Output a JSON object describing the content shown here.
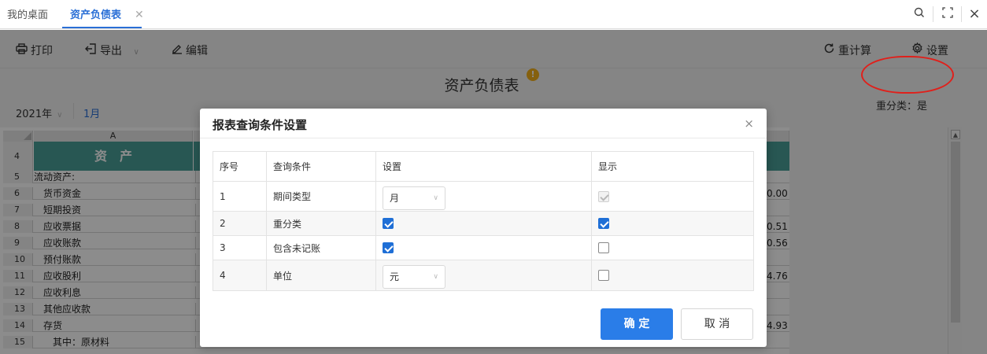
{
  "tabs": [
    {
      "label": "我的桌面"
    },
    {
      "label": "资产负债表"
    }
  ],
  "window": {
    "search_icon": "search-icon",
    "fullscreen_icon": "fullscreen-icon",
    "close_icon": "close-icon",
    "close_glyph": "×",
    "tab_close_glyph": "✕"
  },
  "toolbar": {
    "print": "打印",
    "export": "导出",
    "edit": "编辑",
    "recalc": "重计算",
    "settings": "设置"
  },
  "report": {
    "title": "资产负债表",
    "warn": "!",
    "year": "2021年",
    "month": "1月",
    "reclass_label": "重分类：是"
  },
  "sheet": {
    "col_a": "A",
    "header_asset": "资　产",
    "row4": "4",
    "rows": [
      {
        "num": "5",
        "label": "流动资产:",
        "right": ""
      },
      {
        "num": "6",
        "label": "　货币资金",
        "right": "0.00"
      },
      {
        "num": "7",
        "label": "　短期投资",
        "right": ""
      },
      {
        "num": "8",
        "label": "　应收票据",
        "right": "0.51"
      },
      {
        "num": "9",
        "label": "　应收账款",
        "right": "0.56"
      },
      {
        "num": "10",
        "label": "　预付账款",
        "right": ""
      },
      {
        "num": "11",
        "label": "　应收股利",
        "right": "4.76"
      },
      {
        "num": "12",
        "label": "　应收利息",
        "right": ""
      },
      {
        "num": "13",
        "label": "　其他应收款",
        "right": ""
      },
      {
        "num": "14",
        "label": "　存货",
        "right": "4.93"
      },
      {
        "num": "15",
        "label": "　　其中：原材料",
        "right": ""
      }
    ]
  },
  "modal": {
    "title": "报表查询条件设置",
    "close_glyph": "×",
    "columns": [
      "序号",
      "查询条件",
      "设置",
      "显示"
    ],
    "rows": [
      {
        "no": "1",
        "condition": "期间类型",
        "setting_type": "select",
        "setting_value": "月",
        "setting_checked": false,
        "display_checked": true,
        "display_disabled": true
      },
      {
        "no": "2",
        "condition": "重分类",
        "setting_type": "checkbox",
        "setting_value": "",
        "setting_checked": true,
        "display_checked": true,
        "display_disabled": false
      },
      {
        "no": "3",
        "condition": "包含未记账",
        "setting_type": "checkbox",
        "setting_value": "",
        "setting_checked": true,
        "display_checked": false,
        "display_disabled": false
      },
      {
        "no": "4",
        "condition": "单位",
        "setting_type": "select",
        "setting_value": "元",
        "setting_checked": false,
        "display_checked": false,
        "display_disabled": false
      }
    ],
    "ok": "确 定",
    "cancel": "取 消"
  },
  "colors": {
    "accent": "#2a7de8",
    "teal_header": "#4a9e97",
    "highlight": "#e0201b",
    "warn": "#f3b01b"
  }
}
